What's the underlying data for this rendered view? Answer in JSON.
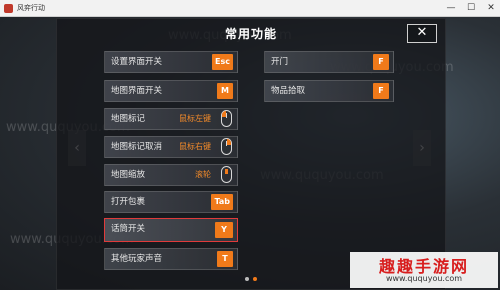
{
  "window": {
    "title": "风弈行动",
    "controls": [
      "—",
      "☐",
      "✕"
    ]
  },
  "panel": {
    "title": "常用功能",
    "close_label": "✕"
  },
  "left_column": [
    {
      "label": "设置界面开关",
      "key": "Esc",
      "type": "key"
    },
    {
      "label": "地图界面开关",
      "key": "M",
      "type": "key"
    },
    {
      "label": "地图标记",
      "mouse_text": "鼠标左键",
      "type": "mouse",
      "mouse_button": "left"
    },
    {
      "label": "地图标记取消",
      "mouse_text": "鼠标右键",
      "type": "mouse",
      "mouse_button": "right"
    },
    {
      "label": "地图缩放",
      "mouse_text": "滚轮",
      "type": "mouse",
      "mouse_button": "wheel"
    },
    {
      "label": "打开包裹",
      "key": "Tab",
      "type": "key"
    },
    {
      "label": "话筒开关",
      "key": "Y",
      "type": "key",
      "selected": true
    },
    {
      "label": "其他玩家声音",
      "key": "T",
      "type": "key"
    }
  ],
  "right_column": [
    {
      "label": "开门",
      "key": "F",
      "type": "key"
    },
    {
      "label": "物品拾取",
      "key": "F",
      "type": "key"
    }
  ],
  "nav": {
    "prev": "‹",
    "next": "›"
  },
  "pagination": {
    "pages": 2,
    "current": 2
  },
  "watermark": {
    "text": "www.ququyou.com",
    "logo_name": "趣趣手游网",
    "logo_url": "www.ququyou.com"
  },
  "colors": {
    "accent": "#f07a1a",
    "selected_border": "#e03b3b",
    "logo_red": "#d81e1e"
  }
}
